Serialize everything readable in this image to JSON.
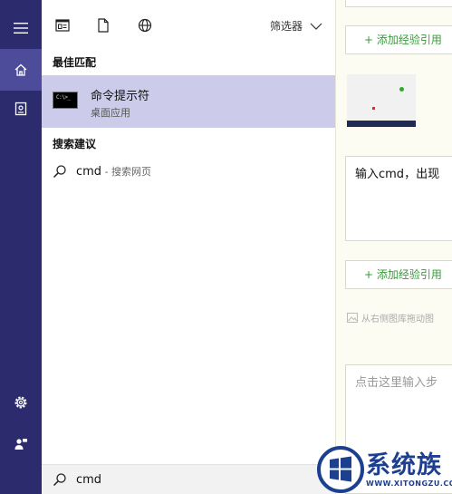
{
  "topbar": {
    "filter_label": "筛选器",
    "icons": [
      "apps-icon",
      "document-icon",
      "globe-icon",
      "chevron-down-icon"
    ]
  },
  "sidebar": {
    "icons": [
      "hamburger-menu-icon",
      "home-icon",
      "notebook-icon",
      "settings-icon",
      "feedback-icon"
    ],
    "active_item": "home-icon"
  },
  "best_match": {
    "section_label": "最佳匹配",
    "title": "命令提示符",
    "subtitle": "桌面应用",
    "icon_text": "C:\\>_"
  },
  "suggestions": {
    "section_label": "搜索建议",
    "items": [
      {
        "term": "cmd",
        "description": " - 搜索网页"
      }
    ]
  },
  "search": {
    "value": "cmd"
  },
  "background_page": {
    "add_reference_1": "+ 添加经验引用",
    "step_text": "输入cmd，出现",
    "add_reference_2": "+ 添加经验引用",
    "image_hint": "从右侧图库拖动图",
    "step_placeholder": "点击这里输入步"
  },
  "watermark": {
    "title": "系统族",
    "url": "WWW.XITONGZU.COM"
  },
  "colors": {
    "rail": "#2b2b6e",
    "rail_active": "#4c4c9a",
    "highlight": "#ccccea",
    "accent_green": "#3a9a3a",
    "watermark_blue": "#1d3f8f"
  }
}
